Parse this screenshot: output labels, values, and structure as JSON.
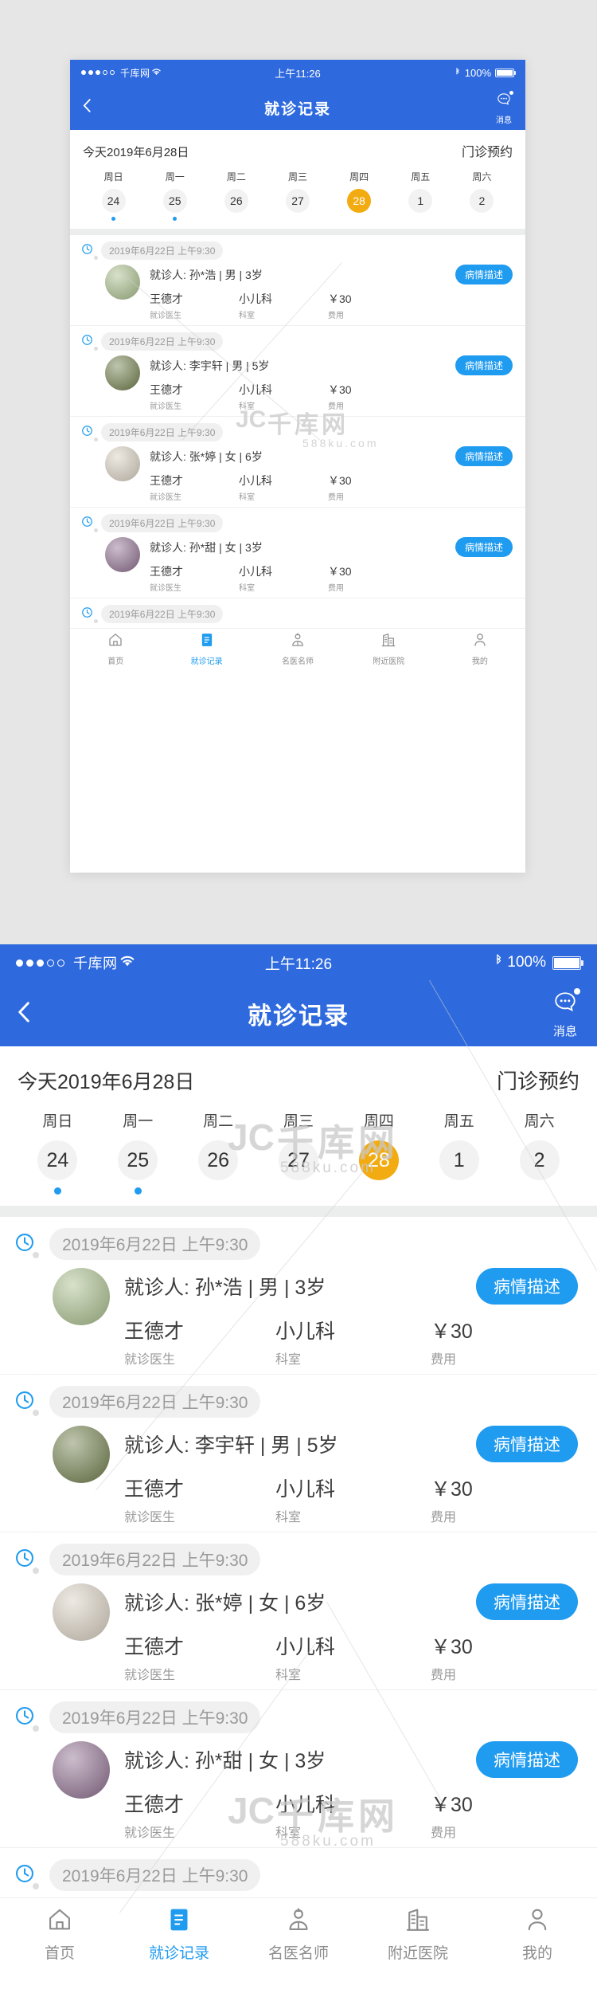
{
  "status_bar": {
    "signal_dots_filled": 3,
    "signal_dots_total": 5,
    "carrier": "千库网",
    "wifi_icon": "wifi-icon",
    "time": "上午11:26",
    "bluetooth_icon": "bluetooth-icon",
    "battery_percent": "100%",
    "battery_icon": "battery-full-icon"
  },
  "nav": {
    "back_icon": "chevron-left-icon",
    "title": "就诊记录",
    "message_icon": "message-bubble-icon",
    "message_label": "消息"
  },
  "calendar": {
    "today_label": "今天2019年6月28日",
    "booking_label": "门诊预约",
    "selected_color": "#f3ab12",
    "mark_color": "#1f9bf0",
    "days": [
      {
        "dow": "周日",
        "num": "24",
        "selected": false,
        "has_mark": true
      },
      {
        "dow": "周一",
        "num": "25",
        "selected": false,
        "has_mark": true
      },
      {
        "dow": "周二",
        "num": "26",
        "selected": false,
        "has_mark": false
      },
      {
        "dow": "周三",
        "num": "27",
        "selected": false,
        "has_mark": false
      },
      {
        "dow": "周四",
        "num": "28",
        "selected": true,
        "has_mark": false
      },
      {
        "dow": "周五",
        "num": "1",
        "selected": false,
        "has_mark": false
      },
      {
        "dow": "周六",
        "num": "2",
        "selected": false,
        "has_mark": false
      }
    ]
  },
  "records": {
    "clock_icon": "clock-icon",
    "accent_color": "#1f9bf0",
    "col_labels": {
      "doctor": "就诊医生",
      "dept": "科室",
      "fee": "费用"
    },
    "items": [
      {
        "time": "2019年6月22日 上午9:30",
        "patient": "就诊人: 孙*浩 | 男 | 3岁",
        "avatar_icon": "patient-avatar-photo",
        "avatar_color": "#a8bd8a",
        "button": "病情描述",
        "doctor": "王德才",
        "dept": "小儿科",
        "fee": "￥30"
      },
      {
        "time": "2019年6月22日 上午9:30",
        "patient": "就诊人: 李宇轩 | 男 | 5岁",
        "avatar_icon": "patient-avatar-photo",
        "avatar_color": "#6f7e4a",
        "button": "病情描述",
        "doctor": "王德才",
        "dept": "小儿科",
        "fee": "￥30"
      },
      {
        "time": "2019年6月22日 上午9:30",
        "patient": "就诊人: 张*婷 | 女 | 6岁",
        "avatar_icon": "patient-avatar-photo",
        "avatar_color": "#d8cfc0",
        "button": "病情描述",
        "doctor": "王德才",
        "dept": "小儿科",
        "fee": "￥30"
      },
      {
        "time": "2019年6月22日 上午9:30",
        "patient": "就诊人: 孙*甜 | 女 | 3岁",
        "avatar_icon": "patient-avatar-photo",
        "avatar_color": "#8d6d8e",
        "button": "病情描述",
        "doctor": "王德才",
        "dept": "小儿科",
        "fee": "￥30"
      }
    ],
    "trailing_time": "2019年6月22日 上午9:30"
  },
  "tabbar": {
    "active_color": "#1f9bf0",
    "inactive_color": "#8d8d8d",
    "tabs": [
      {
        "icon": "home-icon",
        "label": "首页",
        "active": false
      },
      {
        "icon": "document-icon",
        "label": "就诊记录",
        "active": true
      },
      {
        "icon": "doctor-icon",
        "label": "名医名师",
        "active": false
      },
      {
        "icon": "hospital-icon",
        "label": "附近医院",
        "active": false
      },
      {
        "icon": "user-icon",
        "label": "我的",
        "active": false
      }
    ]
  },
  "watermark": {
    "brand": "千库网",
    "site": "588ku.com",
    "logo": "JC"
  },
  "theme": {
    "header_blue": "#2e6ade",
    "accent_blue": "#1f9bf0",
    "highlight_orange": "#f3ab12",
    "page_background": "#e6e6e6"
  }
}
